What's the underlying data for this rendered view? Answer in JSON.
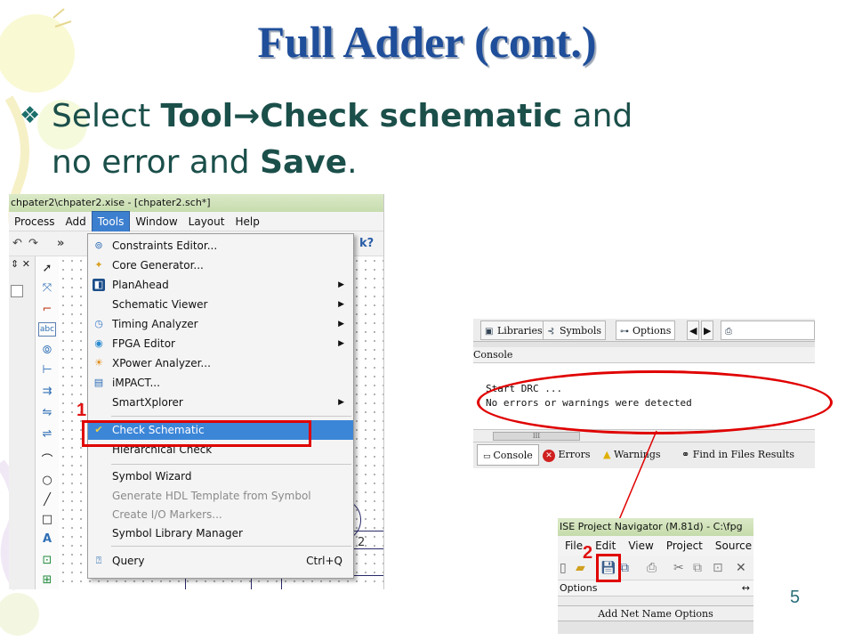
{
  "slide": {
    "title": "Full Adder (cont.)",
    "bullet": {
      "marker": "❖",
      "t1": "Select ",
      "b1": "Tool",
      "arrow": "→",
      "b2": "Check schematic",
      "t2": " and",
      "t3": "no error and ",
      "b3": "Save",
      "t4": "."
    },
    "page_number": "5"
  },
  "colors": {
    "title": "#1f4e9a",
    "text": "#1b4f4a",
    "annotation": "#e00000",
    "menu_highlight": "#3c86d8"
  },
  "shot1": {
    "window_title": "chpater2\\chpater2.xise - [chpater2.sch*]",
    "menus": [
      "Process",
      "Add",
      "Tools",
      "Window",
      "Layout",
      "Help"
    ],
    "active_menu": "Tools",
    "toolbar_overflow": "»",
    "schematic_label": "2",
    "tools_menu": {
      "items": [
        {
          "label": "Constraints Editor...",
          "icon": "constraints-editor-icon"
        },
        {
          "label": "Core Generator...",
          "icon": "core-generator-icon"
        },
        {
          "label": "PlanAhead",
          "icon": "planahead-icon",
          "submenu": true
        },
        {
          "label": "Schematic Viewer",
          "submenu": true
        },
        {
          "label": "Timing Analyzer",
          "icon": "timing-analyzer-icon",
          "submenu": true
        },
        {
          "label": "FPGA Editor",
          "icon": "fpga-editor-icon",
          "submenu": true
        },
        {
          "label": "XPower Analyzer...",
          "icon": "xpower-icon"
        },
        {
          "label": "iMPACT...",
          "icon": "impact-icon"
        },
        {
          "label": "SmartXplorer",
          "submenu": true
        },
        {
          "label": "Check Schematic",
          "icon": "check-schematic-icon",
          "highlighted": true
        },
        {
          "label": "Hierarchical Check"
        },
        {
          "label": "Symbol Wizard"
        },
        {
          "label": "Generate HDL Template from Symbol",
          "disabled": true
        },
        {
          "label": "Create I/O Markers...",
          "disabled": true
        },
        {
          "label": "Symbol Library Manager"
        },
        {
          "label": "Query",
          "icon": "query-icon",
          "shortcut": "Ctrl+Q"
        }
      ]
    },
    "annotation_label": "1"
  },
  "shot2": {
    "top_tabs": [
      "Libraries",
      "Symbols",
      "Options"
    ],
    "console_header": "Console",
    "console_lines": [
      "Start DRC ...",
      "No errors or warnings were detected"
    ],
    "scroll_thumb": "III",
    "bottom_tabs": [
      "Console",
      "Errors",
      "Warnings",
      "Find in Files Results"
    ]
  },
  "shot3": {
    "window_title": "ISE Project Navigator (M.81d) - C:\\fpg",
    "menus": [
      "File",
      "Edit",
      "View",
      "Project",
      "Source"
    ],
    "options_label": "Options",
    "options_arrow": "↔",
    "net_header": "Add Net Name Options",
    "annotation_label": "2"
  }
}
